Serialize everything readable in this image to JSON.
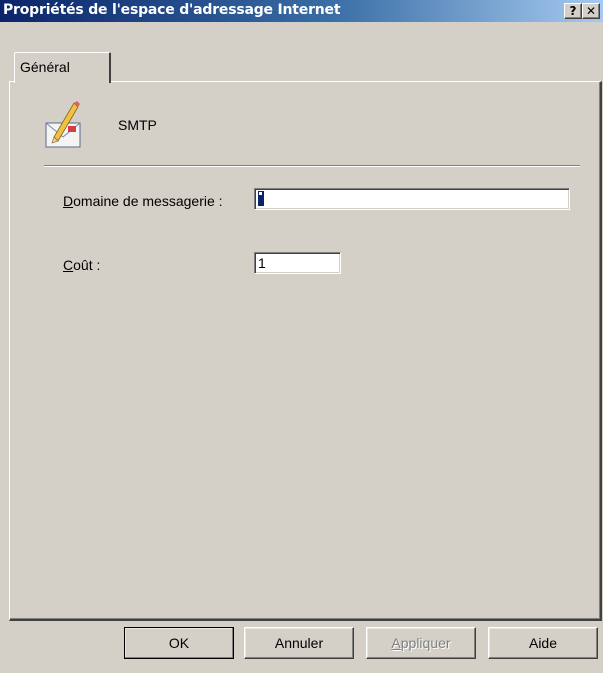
{
  "window": {
    "title": "Propriétés de l'espace d'adressage Internet"
  },
  "titlebar_buttons": {
    "help": "?",
    "close": "✕"
  },
  "tabs": [
    {
      "label": "Général",
      "selected": true
    }
  ],
  "service": {
    "name": "SMTP",
    "icon": "mail-edit-icon"
  },
  "fields": {
    "domain": {
      "label_accel": "D",
      "label_rest": "omaine de messagerie :",
      "value": "*"
    },
    "cost": {
      "label_accel": "C",
      "label_rest": "oût :",
      "value": "1"
    }
  },
  "buttons": {
    "ok": "OK",
    "cancel": "Annuler",
    "apply": {
      "label_accel": "A",
      "label_rest": "ppliquer",
      "enabled": false
    },
    "help": "Aide"
  },
  "colors": {
    "titlebar_start": "#0a246a",
    "titlebar_end": "#a6caf0",
    "face": "#d4d0c8"
  }
}
